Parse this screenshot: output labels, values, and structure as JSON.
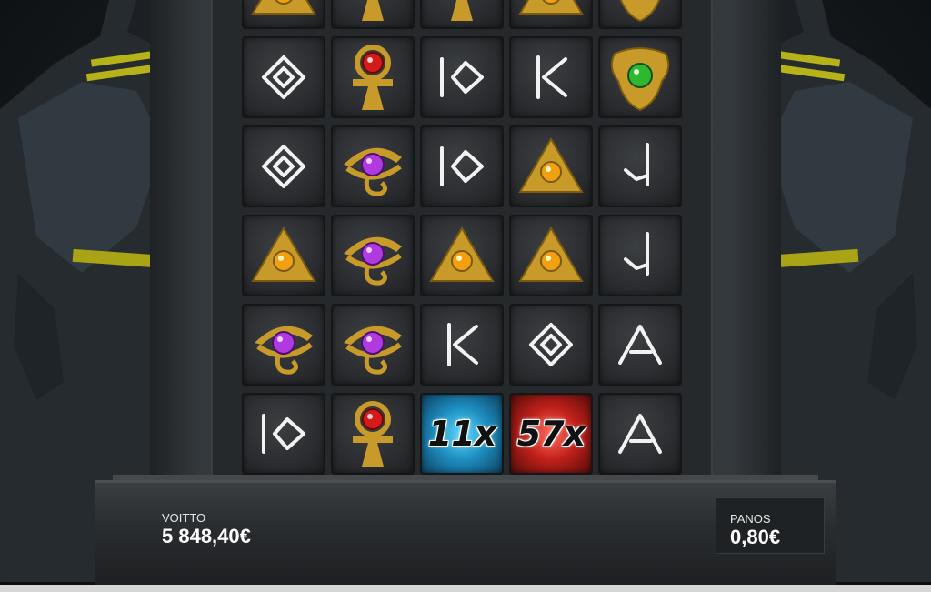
{
  "hud": {
    "win_label": "VOITTO",
    "win_value": "5 848,40€",
    "bet_label": "PANOS",
    "bet_value": "0,80€"
  },
  "grid": {
    "rows": [
      [
        "pyramid",
        "ankh",
        "ankh",
        "pyramid",
        "scarab"
      ],
      [
        "rune-diamond",
        "ankh",
        "rune-io",
        "rune-k",
        "scarab"
      ],
      [
        "rune-diamond",
        "eye",
        "rune-io",
        "pyramid",
        "rune-j"
      ],
      [
        "pyramid",
        "eye",
        "pyramid",
        "pyramid",
        "rune-j"
      ],
      [
        "eye",
        "eye",
        "rune-k",
        "rune-diamond",
        "rune-a"
      ],
      [
        "rune-io",
        "ankh",
        "multiplier-11x",
        "multiplier-57x",
        "rune-a"
      ]
    ],
    "multipliers": {
      "multiplier-11x": {
        "text": "11x",
        "color": "blue"
      },
      "multiplier-57x": {
        "text": "57x",
        "color": "red"
      }
    }
  },
  "colors": {
    "gold": "#c89a2a",
    "gem_red": "#d41a1a",
    "gem_purple": "#b03adf",
    "gem_amber": "#f0a010",
    "gem_green": "#2fb82f"
  }
}
